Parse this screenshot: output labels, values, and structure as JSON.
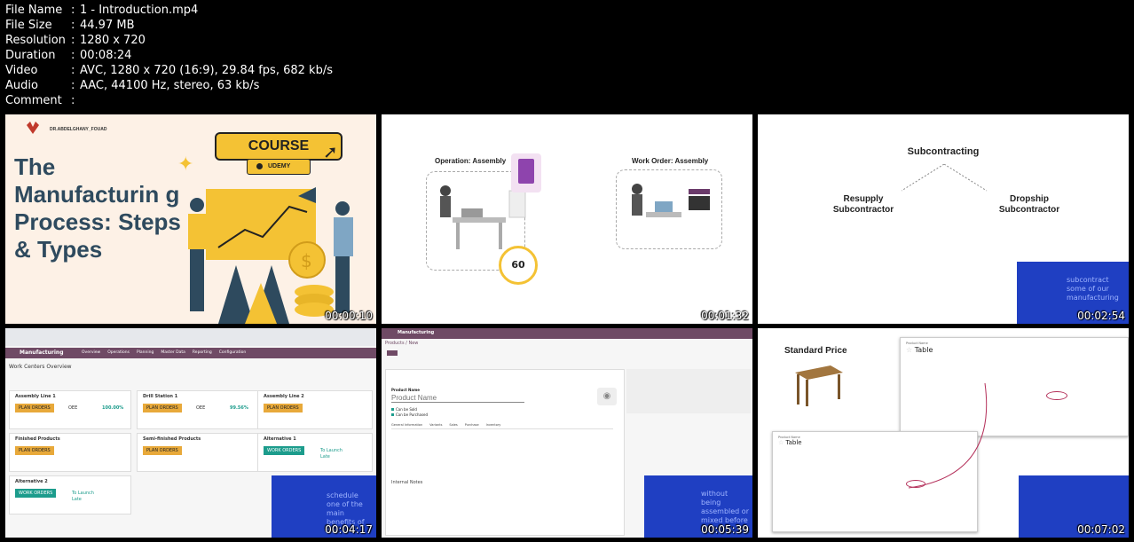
{
  "meta": {
    "rows": [
      {
        "key": "File Name",
        "value": "1 - Introduction.mp4"
      },
      {
        "key": "File Size",
        "value": "44.97 MB"
      },
      {
        "key": "Resolution",
        "value": "1280 x 720"
      },
      {
        "key": "Duration",
        "value": "00:08:24"
      },
      {
        "key": "Video",
        "value": "AVC, 1280 x 720 (16:9), 29.84 fps, 682 kb/s"
      },
      {
        "key": "Audio",
        "value": "AAC, 44100 Hz, stereo, 63 kb/s"
      },
      {
        "key": "Comment",
        "value": ""
      }
    ]
  },
  "thumbs": {
    "t1": {
      "time": "00:00:10",
      "brand": "DR.ABDELGHANY_FOUAD",
      "title": "The Manufacturin g Process: Steps & Types",
      "course": "COURSE",
      "udemy": "UDEMY",
      "colors": {
        "bg": "#fdf1e6",
        "title": "#2e4a5e",
        "yellow": "#f4c234"
      }
    },
    "t2": {
      "time": "00:01:32",
      "op_label": "Operation: Assembly",
      "wo_label": "Work Order: Assembly",
      "timer": "60"
    },
    "t3": {
      "time": "00:02:54",
      "title": "Subcontracting",
      "left": "Resupply Subcontractor",
      "right": "Dropship Subcontractor",
      "corner": "subcontract some of our manufacturing"
    },
    "t4": {
      "time": "00:04:17",
      "app": "Manufacturing",
      "menu": [
        "Overview",
        "Operations",
        "Planning",
        "Master Data",
        "Reporting",
        "Configuration"
      ],
      "page_title": "Work Centers Overview",
      "cards": [
        {
          "name": "Assembly Line 1",
          "button": "PLAN ORDERS",
          "oee_label": "OEE",
          "oee": "100.00%"
        },
        {
          "name": "Drill Station 1",
          "button": "PLAN ORDERS",
          "oee_label": "OEE",
          "oee": "99.56%"
        },
        {
          "name": "Assembly Line 2",
          "button": "PLAN ORDERS"
        },
        {
          "name": "Finished Products",
          "button": "PLAN ORDERS"
        },
        {
          "name": "Semi-finished Products",
          "button": "PLAN ORDERS"
        },
        {
          "name": "Alternative 1",
          "button": "WORK ORDERS",
          "extra1": "To Launch",
          "extra2": "Late"
        },
        {
          "name": "Alternative 2",
          "button": "WORK ORDERS",
          "extra1": "To Launch",
          "extra2": "Late"
        }
      ],
      "corner": "schedule one of the main benefits of the"
    },
    "t5": {
      "time": "00:05:39",
      "app": "Manufacturing",
      "breadcrumb": "Products / New",
      "field_label": "Product Name",
      "placeholder": "Product Name",
      "check1": "Can be Sold",
      "check2": "Can be Purchased",
      "tabs": [
        "General Information",
        "Variants",
        "Sales",
        "Purchase",
        "Inventory"
      ],
      "notes": "Internal Notes",
      "corner": "without being assembled or mixed before"
    },
    "t6": {
      "time": "00:07:02",
      "title": "Standard Price",
      "product_label": "Product Name",
      "product_name": "Table",
      "product_name2": "Table"
    }
  }
}
